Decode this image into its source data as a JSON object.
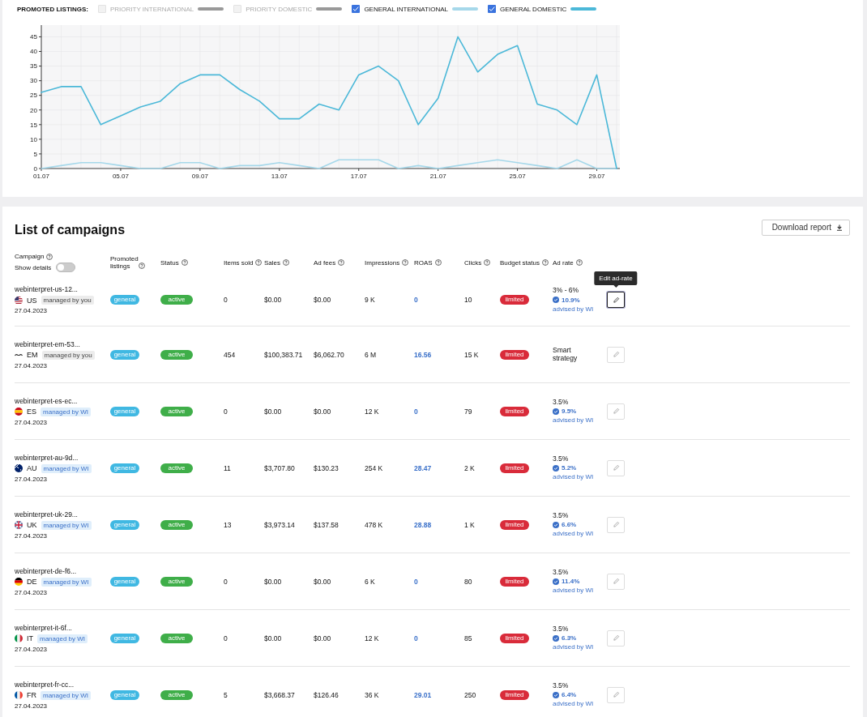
{
  "chart_section": {
    "legend_title": "PROMOTED LISTINGS:",
    "legend": [
      {
        "label": "PRIORITY INTERNATIONAL",
        "checked": false,
        "color": "#999999"
      },
      {
        "label": "PRIORITY DOMESTIC",
        "checked": false,
        "color": "#999999"
      },
      {
        "label": "GENERAL INTERNATIONAL",
        "checked": true,
        "color": "#a6d8ea"
      },
      {
        "label": "GENERAL DOMESTIC",
        "checked": true,
        "color": "#4bb8d8"
      }
    ],
    "chart_data": {
      "type": "line",
      "categories": [
        "01.07",
        null,
        null,
        null,
        "05.07",
        null,
        null,
        null,
        "09.07",
        null,
        null,
        null,
        "13.07",
        null,
        null,
        null,
        "17.07",
        null,
        null,
        null,
        "21.07",
        null,
        null,
        null,
        "25.07",
        null,
        null,
        null,
        "29.07",
        null
      ],
      "grid": true,
      "series": [
        {
          "color": "#a6d8ea",
          "values": [
            0,
            1,
            2,
            2,
            1,
            0,
            0,
            2,
            2,
            0,
            1,
            1,
            2,
            1,
            0,
            3,
            3,
            3,
            0,
            1,
            0,
            1,
            2,
            3,
            2,
            1,
            0,
            3,
            0,
            0
          ]
        },
        {
          "color": "#4bb8d8",
          "values": [
            26,
            28,
            28,
            15,
            18,
            21,
            23,
            29,
            32,
            32,
            27,
            23,
            17,
            17,
            22,
            20,
            32,
            35,
            30,
            15,
            24,
            45,
            33,
            39,
            42,
            22,
            20,
            15,
            32,
            0
          ]
        }
      ],
      "ylim": [
        0,
        49
      ],
      "yticks": [
        0,
        5,
        10,
        15,
        20,
        25,
        30,
        35,
        40,
        45
      ]
    }
  },
  "campaigns": {
    "title": "List of campaigns",
    "download_button": "Download report",
    "show_details": {
      "label": "Show details",
      "on": false
    },
    "columns": [
      {
        "label": "Campaign"
      },
      {
        "label": "Promoted listings"
      },
      {
        "label": "Status"
      },
      {
        "label": "Items sold"
      },
      {
        "label": "Sales"
      },
      {
        "label": "Ad fees"
      },
      {
        "label": "Impressions"
      },
      {
        "label": "ROAS"
      },
      {
        "label": "Clicks"
      },
      {
        "label": "Budget status"
      },
      {
        "label": "Ad rate"
      }
    ],
    "rows": [
      {
        "name": "webinterpret-us-12...",
        "flag": {
          "kind": "us"
        },
        "country": "US",
        "manager": "managed by you",
        "kind": "self",
        "date": "27.04.2023",
        "listing": "general",
        "status": "active",
        "items_sold": "0",
        "sales": "$0.00",
        "ad_fees": "$0.00",
        "impressions": "9 K",
        "roas": "0",
        "clicks": "10",
        "budget": "limited",
        "ad_rate": "3% - 6%",
        "advised_rate": "10.9%",
        "advised_label": "advised by WI",
        "hovered": true,
        "tooltip": "Edit ad-rate"
      },
      {
        "name": "webinterpret-em-53...",
        "flag": {
          "kind": "em"
        },
        "country": "EM",
        "manager": "managed by you",
        "kind": "self",
        "date": "27.04.2023",
        "listing": "general",
        "status": "active",
        "items_sold": "454",
        "sales": "$100,383.71",
        "ad_fees": "$6,062.70",
        "impressions": "6 M",
        "roas": "16.56",
        "clicks": "15 K",
        "budget": "limited",
        "ad_rate": "Smart strategy",
        "hovered": false
      },
      {
        "name": "webinterpret-es-ec...",
        "flag": {
          "kind": "es"
        },
        "country": "ES",
        "manager": "managed by WI",
        "kind": "wi",
        "date": "27.04.2023",
        "listing": "general",
        "status": "active",
        "items_sold": "0",
        "sales": "$0.00",
        "ad_fees": "$0.00",
        "impressions": "12 K",
        "roas": "0",
        "clicks": "79",
        "budget": "limited",
        "ad_rate": "3.5%",
        "advised_rate": "9.5%",
        "advised_label": "advised by WI",
        "hovered": false
      },
      {
        "name": "webinterpret-au-9d...",
        "flag": {
          "kind": "au"
        },
        "country": "AU",
        "manager": "managed by WI",
        "kind": "wi",
        "date": "27.04.2023",
        "listing": "general",
        "status": "active",
        "items_sold": "11",
        "sales": "$3,707.80",
        "ad_fees": "$130.23",
        "impressions": "254 K",
        "roas": "28.47",
        "clicks": "2 K",
        "budget": "limited",
        "ad_rate": "3.5%",
        "advised_rate": "5.2%",
        "advised_label": "advised by WI",
        "hovered": false
      },
      {
        "name": "webinterpret-uk-29...",
        "flag": {
          "kind": "uk"
        },
        "country": "UK",
        "manager": "managed by WI",
        "kind": "wi",
        "date": "27.04.2023",
        "listing": "general",
        "status": "active",
        "items_sold": "13",
        "sales": "$3,973.14",
        "ad_fees": "$137.58",
        "impressions": "478 K",
        "roas": "28.88",
        "clicks": "1 K",
        "budget": "limited",
        "ad_rate": "3.5%",
        "advised_rate": "6.6%",
        "advised_label": "advised by WI",
        "hovered": false
      },
      {
        "name": "webinterpret-de-f6...",
        "flag": {
          "kind": "de"
        },
        "country": "DE",
        "manager": "managed by WI",
        "kind": "wi",
        "date": "27.04.2023",
        "listing": "general",
        "status": "active",
        "items_sold": "0",
        "sales": "$0.00",
        "ad_fees": "$0.00",
        "impressions": "6 K",
        "roas": "0",
        "clicks": "80",
        "budget": "limited",
        "ad_rate": "3.5%",
        "advised_rate": "11.4%",
        "advised_label": "advised by WI",
        "hovered": false
      },
      {
        "name": "webinterpret-it-6f...",
        "flag": {
          "kind": "it"
        },
        "country": "IT",
        "manager": "managed by WI",
        "kind": "wi",
        "date": "27.04.2023",
        "listing": "general",
        "status": "active",
        "items_sold": "0",
        "sales": "$0.00",
        "ad_fees": "$0.00",
        "impressions": "12 K",
        "roas": "0",
        "clicks": "85",
        "budget": "limited",
        "ad_rate": "3.5%",
        "advised_rate": "6.3%",
        "advised_label": "advised by WI",
        "hovered": false
      },
      {
        "name": "webinterpret-fr-cc...",
        "flag": {
          "kind": "fr"
        },
        "country": "FR",
        "manager": "managed by WI",
        "kind": "wi",
        "date": "27.04.2023",
        "listing": "general",
        "status": "active",
        "items_sold": "5",
        "sales": "$3,668.37",
        "ad_fees": "$126.46",
        "impressions": "36 K",
        "roas": "29.01",
        "clicks": "250",
        "budget": "limited",
        "ad_rate": "3.5%",
        "advised_rate": "6.4%",
        "advised_label": "advised by WI",
        "hovered": false
      }
    ]
  }
}
